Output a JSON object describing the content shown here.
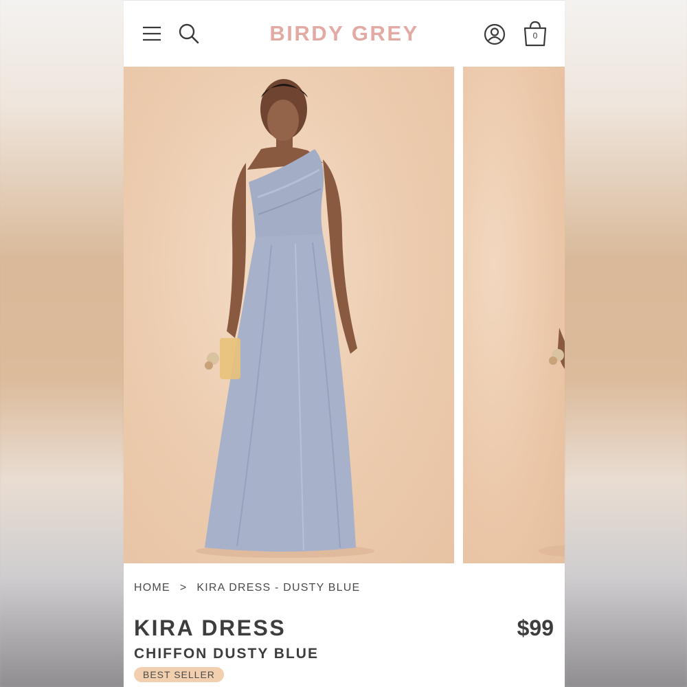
{
  "header": {
    "brand": "BIRDY GREY",
    "cart_count": "0",
    "icons": [
      "hamburger-menu-icon",
      "search-icon",
      "account-icon",
      "shopping-bag-icon"
    ]
  },
  "gallery": {
    "images": [
      "model-one-shoulder-dress-photo",
      "model-dress-photo-next"
    ]
  },
  "breadcrumb": {
    "home": "HOME",
    "separator": ">",
    "current": "KIRA DRESS - DUSTY BLUE"
  },
  "product": {
    "name": "KIRA DRESS",
    "subtitle": "CHIFFON DUSTY BLUE",
    "price": "$99",
    "badge": "BEST SELLER"
  },
  "colors": {
    "brand": "#e3aaa4",
    "badge_bg": "#f2cfae",
    "dress": "#a7b1c9",
    "backdrop": "#ecc9ab"
  }
}
